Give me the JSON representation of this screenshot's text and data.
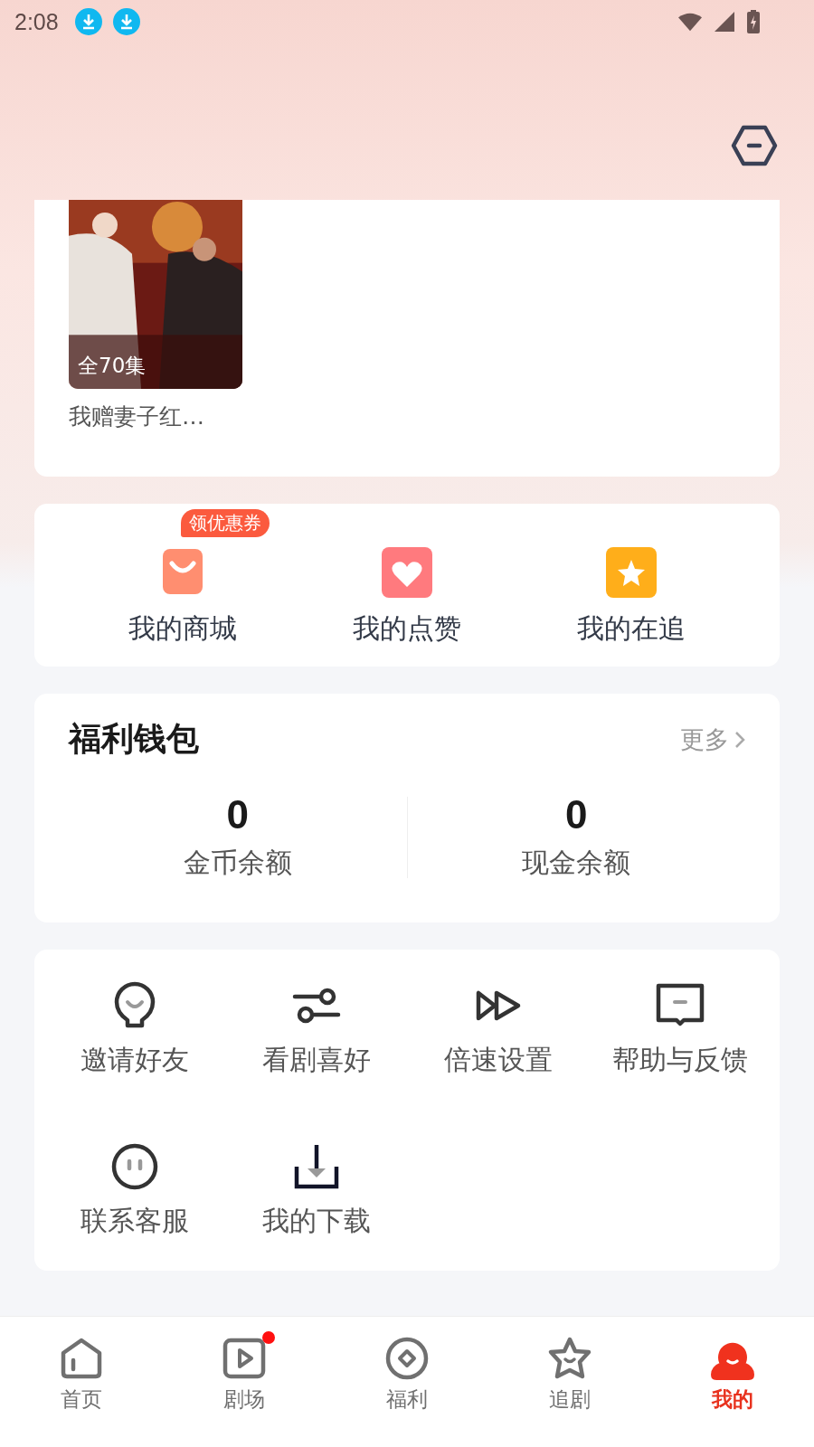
{
  "status_bar": {
    "time": "2:08",
    "notifications": [
      {
        "kind": "download"
      },
      {
        "kind": "download"
      }
    ]
  },
  "history": [
    {
      "badge": "全70集",
      "title": "我赠妻子红…"
    }
  ],
  "shortcuts": [
    {
      "kind": "bag",
      "label": "我的商城",
      "tag": "领优惠券"
    },
    {
      "kind": "heart",
      "label": "我的点赞"
    },
    {
      "kind": "star",
      "label": "我的在追"
    }
  ],
  "wallet": {
    "title": "福利钱包",
    "more": "更多",
    "balances": [
      {
        "value": "0",
        "label": "金币余额"
      },
      {
        "value": "0",
        "label": "现金余额"
      }
    ]
  },
  "tools": [
    {
      "kind": "invite",
      "label": "邀请好友"
    },
    {
      "kind": "prefs",
      "label": "看剧喜好"
    },
    {
      "kind": "speed",
      "label": "倍速设置"
    },
    {
      "kind": "feedback",
      "label": "帮助与反馈"
    },
    {
      "kind": "service",
      "label": "联系客服"
    },
    {
      "kind": "download",
      "label": "我的下载"
    }
  ],
  "tabs": [
    {
      "kind": "home",
      "label": "首页",
      "selected": false,
      "dot": false
    },
    {
      "kind": "theater",
      "label": "剧场",
      "selected": false,
      "dot": true
    },
    {
      "kind": "welfare",
      "label": "福利",
      "selected": false,
      "dot": false
    },
    {
      "kind": "follow",
      "label": "追剧",
      "selected": false,
      "dot": false
    },
    {
      "kind": "me",
      "label": "我的",
      "selected": true,
      "dot": false
    }
  ]
}
